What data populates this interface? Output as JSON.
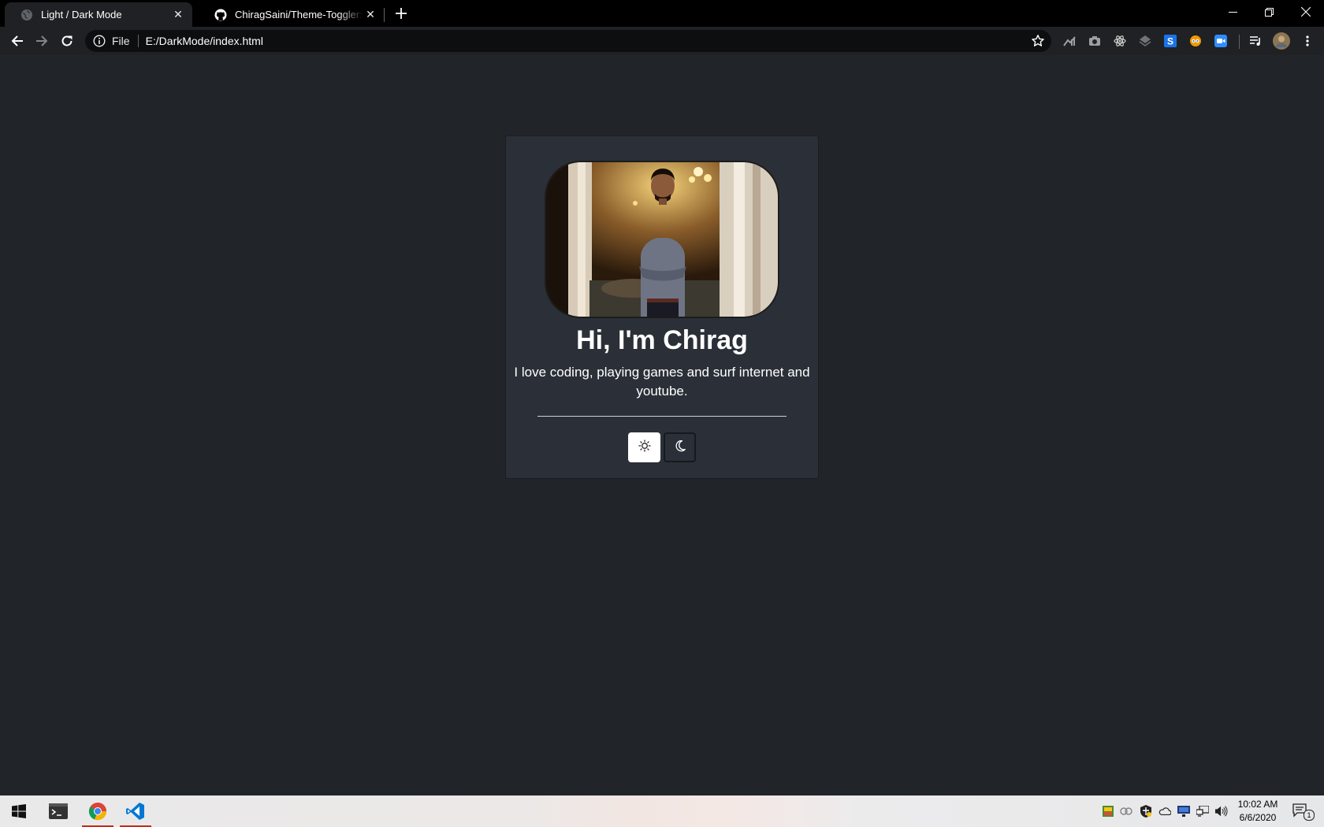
{
  "browser": {
    "tabs": [
      {
        "title": "Light / Dark Mode",
        "active": true,
        "favicon": "globe-icon"
      },
      {
        "title": "ChiragSaini/Theme-Toggler: Simple",
        "active": false,
        "favicon": "github-icon"
      }
    ],
    "address": {
      "scheme": "File",
      "url": "E:/DarkMode/index.html"
    },
    "extensions": [
      "chart-extension-icon",
      "camera-extension-icon",
      "react-devtools-icon",
      "layers-extension-icon",
      "skype-extension-icon",
      "reader-extension-icon",
      "zoom-extension-icon"
    ]
  },
  "page": {
    "heading": "Hi, I'm Chirag",
    "bio": "I love coding, playing games and surf internet and youtube.",
    "theme": "dark",
    "colors": {
      "background": "#212529",
      "card": "#2b3038",
      "text": "#ffffff"
    }
  },
  "taskbar": {
    "apps": [
      "terminal-icon",
      "chrome-icon",
      "vscode-icon"
    ],
    "time": "10:02 AM",
    "date": "6/6/2020",
    "notification_count": "1"
  }
}
